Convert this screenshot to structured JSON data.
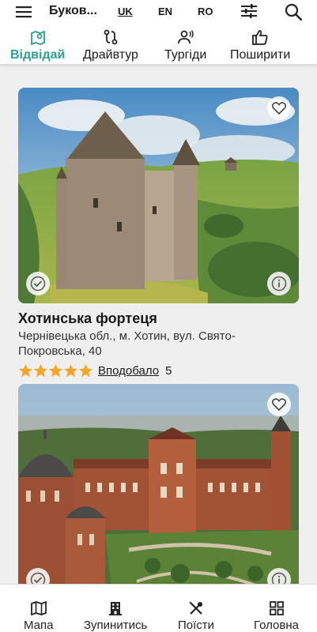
{
  "header": {
    "title": "Буков...",
    "languages": [
      "UK",
      "EN",
      "RO"
    ],
    "active_language": "UK"
  },
  "tabs": [
    {
      "label": "Відвідай",
      "icon": "map-pin-icon",
      "active": true
    },
    {
      "label": "Драйвтур",
      "icon": "route-icon",
      "active": false
    },
    {
      "label": "Тургіди",
      "icon": "guide-icon",
      "active": false
    },
    {
      "label": "Поширити",
      "icon": "thumbs-up-icon",
      "active": false
    }
  ],
  "places": [
    {
      "title": "Хотинська фортеця",
      "address": "Чернівецька обл., м. Хотин, вул. Свято-Покровська, 40",
      "rating": 5,
      "likes_label": "Вподобало",
      "likes_count": "5"
    },
    {
      "title": "",
      "address": "",
      "rating": null,
      "likes_label": "",
      "likes_count": ""
    }
  ],
  "bottom_nav": [
    {
      "label": "Мапа",
      "icon": "map-icon"
    },
    {
      "label": "Зупинитись",
      "icon": "hotel-icon"
    },
    {
      "label": "Поїсти",
      "icon": "food-icon"
    },
    {
      "label": "Головна",
      "icon": "grid-icon"
    }
  ],
  "colors": {
    "accent": "#2e9f8d",
    "star": "#f4a62a",
    "background": "#efefef"
  }
}
